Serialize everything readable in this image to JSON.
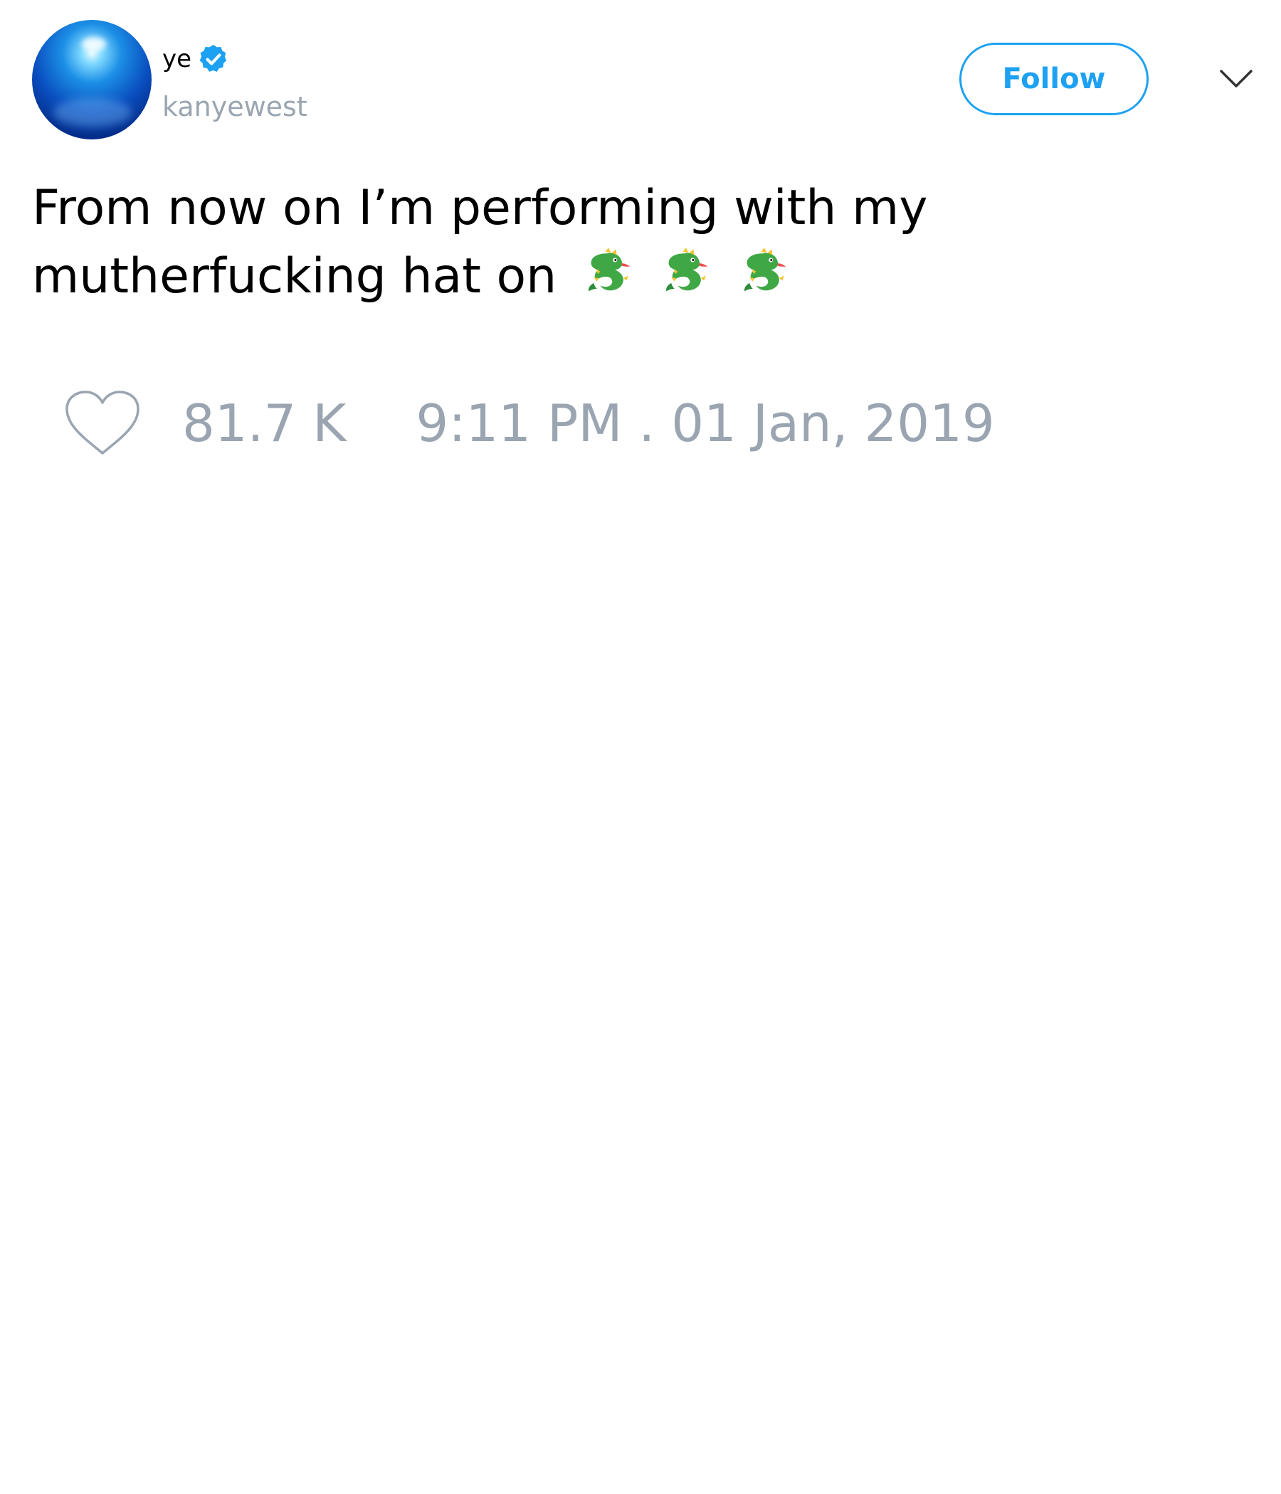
{
  "author": {
    "display_name": "ye",
    "handle": "kanyewest",
    "verified": true,
    "avatar": "blue-orb"
  },
  "header": {
    "follow_label": "Follow",
    "menu_icon": "chevron-down-icon"
  },
  "tweet": {
    "text": "From now on I’m performing with my mutherfucking hat on",
    "emojis": [
      "dragon",
      "dragon",
      "dragon"
    ]
  },
  "footer": {
    "like_icon": "heart-icon",
    "like_count": "81.7 K",
    "timestamp": "9:11 PM . 01 Jan, 2019"
  },
  "colors": {
    "accent": "#1da1f2",
    "muted": "#9aa5b1",
    "text": "#000000"
  }
}
